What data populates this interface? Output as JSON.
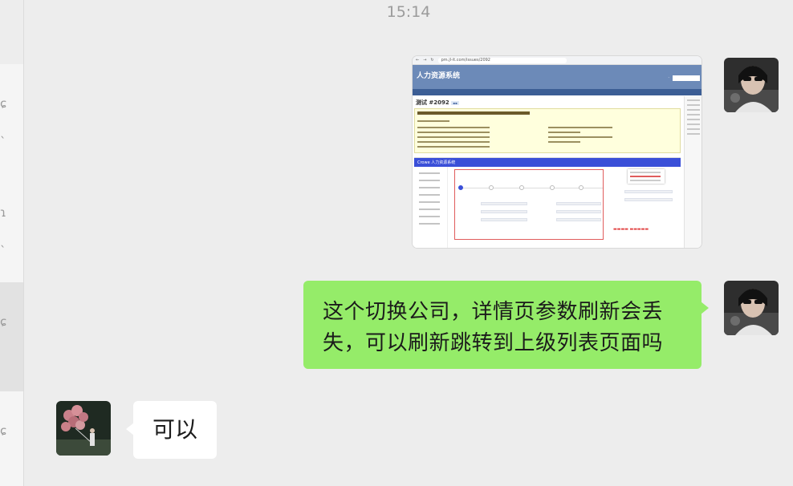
{
  "chat": {
    "timestamp": "15:14",
    "messages": [
      {
        "sender": "self",
        "type": "image",
        "screenshot": {
          "url": "pm.jl-it.com/issues/2092",
          "app_title": "人力资源系统",
          "issue_title": "测试 #2092",
          "embedded_brand": "Crowe  人力资源系统"
        }
      },
      {
        "sender": "self",
        "type": "text",
        "text_line1": "这个切换公司，详情页参数刷新会丢",
        "text_line2": "失，可以刷新跳转到上级列表页面吗"
      },
      {
        "sender": "other",
        "type": "text",
        "text": "可以"
      }
    ]
  },
  "colors": {
    "self_bubble": "#95ec69",
    "other_bubble": "#ffffff",
    "background": "#ededed"
  }
}
